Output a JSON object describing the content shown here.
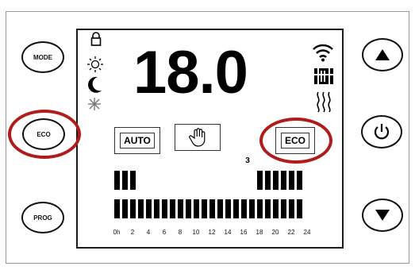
{
  "buttons": {
    "mode": "MODE",
    "eco": "ECO",
    "prog": "PROG"
  },
  "display": {
    "temperature": "18.0",
    "mode_auto": "AUTO",
    "mode_eco": "ECO",
    "current_hour_marker": "3"
  },
  "program": {
    "hour_labels": [
      "0h",
      "2",
      "4",
      "6",
      "8",
      "10",
      "12",
      "14",
      "16",
      "18",
      "20",
      "22",
      "24"
    ],
    "top_row_segments": [
      true,
      true,
      true,
      false,
      false,
      false,
      false,
      false,
      false,
      false,
      false,
      false,
      false,
      false,
      false,
      false,
      false,
      false,
      true,
      true,
      true,
      true,
      true,
      true
    ],
    "bottom_row_segments": [
      true,
      true,
      true,
      true,
      true,
      true,
      true,
      true,
      true,
      true,
      true,
      true,
      true,
      true,
      true,
      true,
      true,
      true,
      true,
      true,
      true,
      true,
      true,
      true
    ]
  },
  "icons": {
    "left_status": [
      "lock-icon",
      "sun-icon",
      "moon-icon",
      "snowflake-icon"
    ],
    "right_status": [
      "wifi-icon",
      "radiator-icon",
      "heat-waves-icon"
    ],
    "right_buttons": [
      "up-arrow-icon",
      "power-icon",
      "down-arrow-icon"
    ]
  },
  "colors": {
    "highlight": "#b01c1c"
  }
}
